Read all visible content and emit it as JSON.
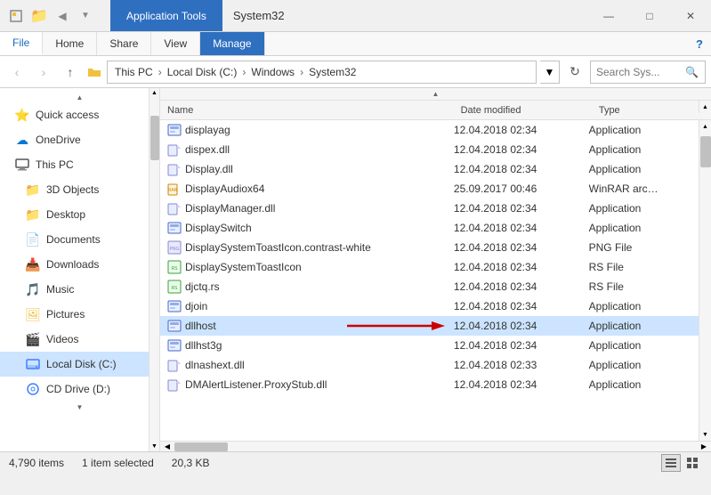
{
  "titleBar": {
    "appTools": "Application Tools",
    "title": "System32",
    "minimize": "—",
    "maximize": "□",
    "close": "✕"
  },
  "ribbon": {
    "tabs": [
      {
        "id": "file",
        "label": "File"
      },
      {
        "id": "home",
        "label": "Home"
      },
      {
        "id": "share",
        "label": "Share"
      },
      {
        "id": "view",
        "label": "View"
      },
      {
        "id": "manage",
        "label": "Manage"
      }
    ],
    "help": "?"
  },
  "addressBar": {
    "path": [
      "This PC",
      "Local Disk (C:)",
      "Windows",
      "System32"
    ],
    "searchPlaceholder": "Search Sys..."
  },
  "sidebar": {
    "items": [
      {
        "id": "quick-access",
        "label": "Quick access",
        "icon": "⭐"
      },
      {
        "id": "onedrive",
        "label": "OneDrive",
        "icon": "☁"
      },
      {
        "id": "this-pc",
        "label": "This PC",
        "icon": "💻"
      },
      {
        "id": "3d-objects",
        "label": "3D Objects",
        "icon": "📁"
      },
      {
        "id": "desktop",
        "label": "Desktop",
        "icon": "📁"
      },
      {
        "id": "documents",
        "label": "Documents",
        "icon": "📄"
      },
      {
        "id": "downloads",
        "label": "Downloads",
        "icon": "📥"
      },
      {
        "id": "music",
        "label": "Music",
        "icon": "🎵"
      },
      {
        "id": "pictures",
        "label": "Pictures",
        "icon": "🖼"
      },
      {
        "id": "videos",
        "label": "Videos",
        "icon": "🎬"
      },
      {
        "id": "local-disk-c",
        "label": "Local Disk (C:)",
        "icon": "💿"
      },
      {
        "id": "cd-drive-d",
        "label": "CD Drive (D:)",
        "icon": "💿"
      }
    ]
  },
  "fileList": {
    "columns": [
      {
        "id": "name",
        "label": "Name"
      },
      {
        "id": "date",
        "label": "Date modified"
      },
      {
        "id": "type",
        "label": "Type"
      }
    ],
    "files": [
      {
        "name": "displayag",
        "date": "12.04.2018 02:34",
        "type": "Application",
        "selected": false
      },
      {
        "name": "dispex.dll",
        "date": "12.04.2018 02:34",
        "type": "Application",
        "selected": false
      },
      {
        "name": "Display.dll",
        "date": "12.04.2018 02:34",
        "type": "Application",
        "selected": false
      },
      {
        "name": "DisplayAudiox64",
        "date": "25.09.2017 00:46",
        "type": "WinRAR arc…",
        "selected": false
      },
      {
        "name": "DisplayManager.dll",
        "date": "12.04.2018 02:34",
        "type": "Application",
        "selected": false
      },
      {
        "name": "DisplaySwitch",
        "date": "12.04.2018 02:34",
        "type": "Application",
        "selected": false
      },
      {
        "name": "DisplaySystemToastIcon.contrast-white",
        "date": "12.04.2018 02:34",
        "type": "PNG File",
        "selected": false
      },
      {
        "name": "DisplaySystemToastIcon",
        "date": "12.04.2018 02:34",
        "type": "RS File",
        "selected": false
      },
      {
        "name": "djctq.rs",
        "date": "12.04.2018 02:34",
        "type": "RS File",
        "selected": false
      },
      {
        "name": "djoin",
        "date": "12.04.2018 02:34",
        "type": "Application",
        "selected": false
      },
      {
        "name": "dllhost",
        "date": "12.04.2018 02:34",
        "type": "Application",
        "selected": true
      },
      {
        "name": "dllhst3g",
        "date": "12.04.2018 02:34",
        "type": "Application",
        "selected": false
      },
      {
        "name": "dlnashext.dll",
        "date": "12.04.2018 02:33",
        "type": "Application",
        "selected": false
      },
      {
        "name": "DMAlertListener.ProxyStub.dll",
        "date": "12.04.2018 02:34",
        "type": "Application",
        "selected": false
      }
    ]
  },
  "statusBar": {
    "itemCount": "4,790 items",
    "selected": "1 item selected",
    "size": "20,3 KB"
  },
  "colors": {
    "accent": "#2f6fc0",
    "selected": "#cce4ff",
    "hover": "#e8f0fe",
    "arrow": "#cc0000"
  }
}
